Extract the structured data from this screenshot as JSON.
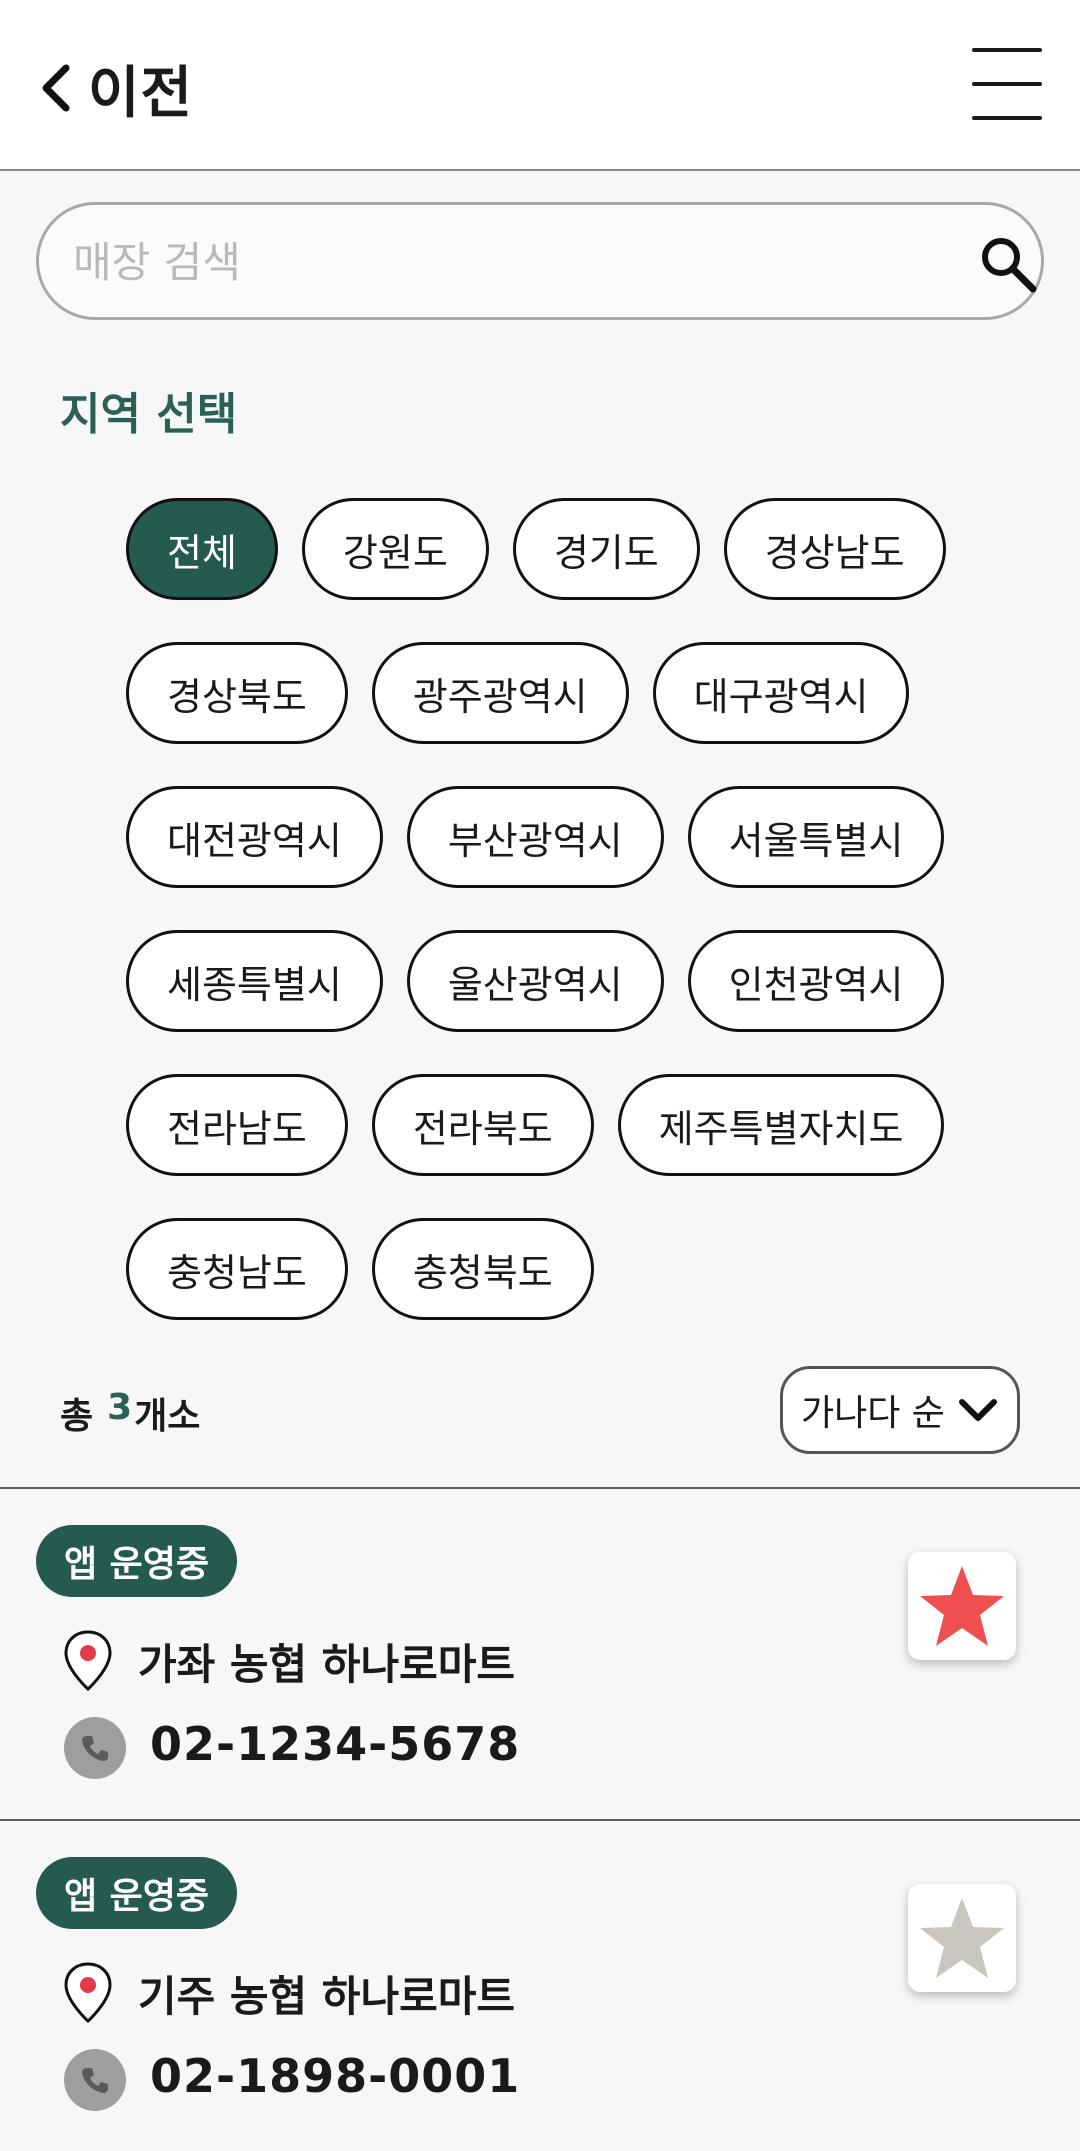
{
  "header": {
    "back_label": "이전"
  },
  "search": {
    "placeholder": "매장 검색"
  },
  "region": {
    "title": "지역 선택",
    "selected": "전체",
    "rows": [
      [
        "전체",
        "강원도",
        "경기도",
        "경상남도"
      ],
      [
        "경상북도",
        "광주광역시",
        "대구광역시"
      ],
      [
        "대전광역시",
        "부산광역시",
        "서울특별시"
      ],
      [
        "세종특별시",
        "울산광역시",
        "인천광역시"
      ],
      [
        "전라남도",
        "전라북도",
        "제주특별자치도"
      ],
      [
        "충청남도",
        "충청북도"
      ]
    ]
  },
  "results": {
    "prefix": "총",
    "count": "3",
    "suffix": "개소"
  },
  "sort": {
    "label": "가나다 순"
  },
  "stores": [
    {
      "badge": "앱 운영중",
      "name": "가좌 농협 하나로마트",
      "phone": "02-1234-5678",
      "favorite": true
    },
    {
      "badge": "앱 운영중",
      "name": "기주 농협 하나로마트",
      "phone": "02-1898-0001",
      "favorite": false
    }
  ],
  "colors": {
    "accent": "#245a50",
    "star_on": "#ef4f4f",
    "star_off": "#c9c6bf",
    "pin": "#e23b4a"
  }
}
